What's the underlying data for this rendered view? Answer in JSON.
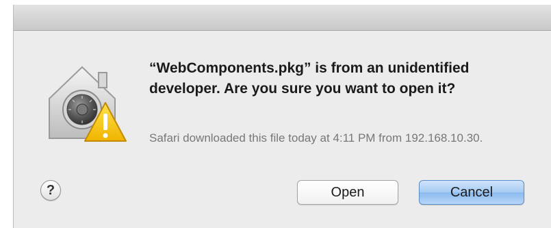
{
  "dialog": {
    "icon": "gatekeeper-warning-icon",
    "headline": "“WebComponents.pkg” is from an unidentified developer. Are you sure you want to open it?",
    "info": "Safari downloaded this file today at 4:11 PM from 192.168.10.30.",
    "help_label": "?",
    "buttons": {
      "open_label": "Open",
      "cancel_label": "Cancel"
    },
    "colors": {
      "default_button": "#a6cbf3",
      "warning": "#f5c400"
    }
  }
}
